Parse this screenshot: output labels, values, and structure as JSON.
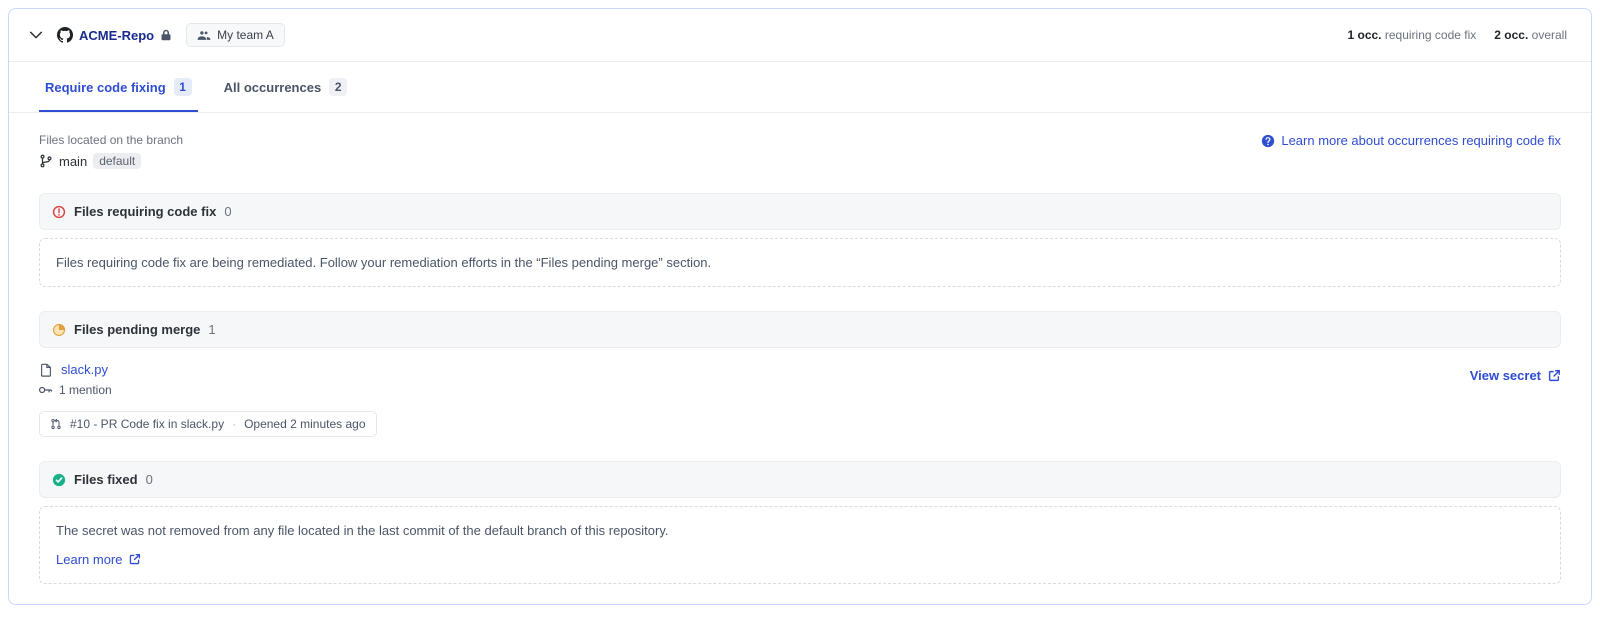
{
  "header": {
    "repo_name": "ACME-Repo",
    "team_label": "My team A",
    "occ_prefix_1": "1 occ.",
    "occ_suffix_1": "requiring code fix",
    "occ_prefix_2": "2 occ.",
    "occ_suffix_2": "overall"
  },
  "tabs": {
    "fix_label": "Require code fixing",
    "fix_count": "1",
    "all_label": "All occurrences",
    "all_count": "2"
  },
  "branch": {
    "label": "Files located on the branch",
    "name": "main",
    "default_label": "default"
  },
  "learn_link": "Learn more about occurrences requiring code fix",
  "sections": {
    "requiring": {
      "title": "Files requiring code fix",
      "count": "0",
      "message": "Files requiring code fix are being remediated. Follow your remediation efforts in the “Files pending merge” section."
    },
    "pending": {
      "title": "Files pending merge",
      "count": "1"
    },
    "fixed": {
      "title": "Files fixed",
      "count": "0",
      "message": "The secret was not removed from any file located in the last commit of the default branch of this repository.",
      "learn_more": "Learn more"
    }
  },
  "file": {
    "name": "slack.py",
    "mention": "1 mention",
    "pr_text": "#10 - PR Code fix in slack.py",
    "pr_time": "Opened 2 minutes ago",
    "view_secret": "View secret"
  }
}
